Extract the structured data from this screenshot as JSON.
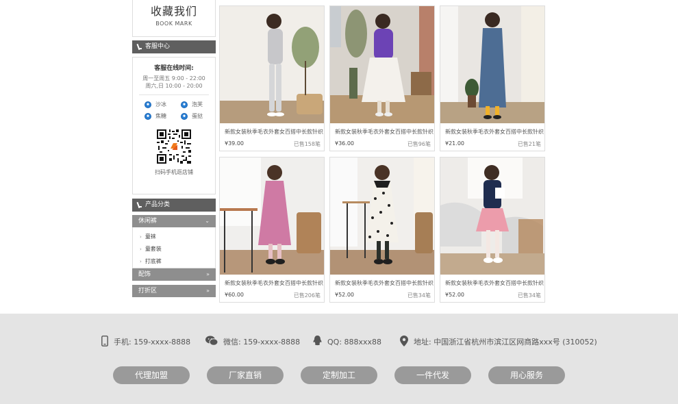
{
  "bookmark": {
    "title_zh": "收藏我们",
    "title_en": "BOOK MARK"
  },
  "service": {
    "header": "客服中心",
    "online_title": "客服在线时间:",
    "weekday_hours": "周一至周五 9:00 - 22:00",
    "weekend_hours": "周六,日 10:00 - 20:00",
    "agents": [
      "沙冰",
      "泡芙",
      "焦糖",
      "蛋挞"
    ],
    "qr_caption": "扫码手机逛店铺"
  },
  "categories": {
    "header": "产品分类",
    "groups": [
      {
        "label": "休闲裤",
        "expanded": true,
        "items": [
          "童袜",
          "童套装",
          "打底裤"
        ]
      },
      {
        "label": "配饰",
        "expanded": false
      },
      {
        "label": "打折区",
        "expanded": false
      }
    ]
  },
  "products": [
    {
      "name": "新款女装秋季毛衣外套女百搭中长款针织",
      "price": "¥39.00",
      "sold": "已售158笔",
      "outfit": "grey-tracksuit"
    },
    {
      "name": "新款女装秋季毛衣外套女百搭中长款针织",
      "price": "¥36.00",
      "sold": "已售96笔",
      "outfit": "purple-tutu"
    },
    {
      "name": "新款女装秋季毛衣外套女百搭中长款针织",
      "price": "¥21.00",
      "sold": "已售21笔",
      "outfit": "denim-dress"
    },
    {
      "name": "新款女装秋季毛衣外套女百搭中长款针织",
      "price": "¥60.00",
      "sold": "已售206笔",
      "outfit": "pink-dress"
    },
    {
      "name": "新款女装秋季毛衣外套女百搭中长款针织",
      "price": "¥52.00",
      "sold": "已售34笔",
      "outfit": "polka-dress"
    },
    {
      "name": "新款女装秋季毛衣外套女百搭中长款针织",
      "price": "¥52.00",
      "sold": "已售34笔",
      "outfit": "navy-pink-dress"
    }
  ],
  "footer": {
    "phone": "手机: 159-xxxx-8888",
    "wechat": "微信: 159-xxxx-8888",
    "qq": "QQ: 888xxx88",
    "address": "地址: 中国浙江省杭州市滨江区网商路xxx号 (310052)",
    "buttons": [
      "代理加盟",
      "厂家直销",
      "定制加工",
      "一件代发",
      "用心服务"
    ]
  },
  "colors": {
    "dark_header": "#5f5f5f",
    "category_bar": "#8e8e8e",
    "button": "#9a9a9a",
    "footer_bg": "#e4e4e4",
    "qq_blue": "#2a7fd4"
  }
}
